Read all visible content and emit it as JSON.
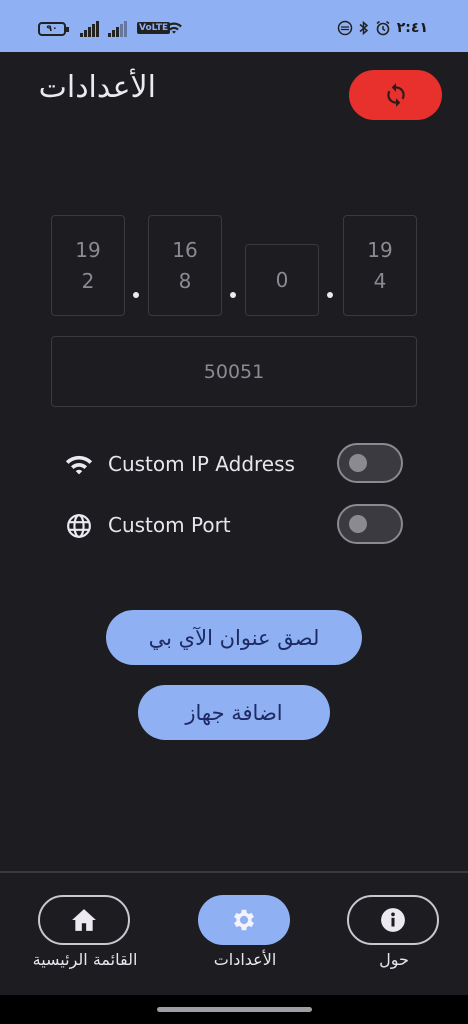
{
  "status_bar": {
    "battery": "٩٠",
    "volte": "VoLTE",
    "time": "٢:٤١",
    "icons": [
      "signal-icon",
      "signal-icon",
      "volte-icon",
      "wifi-icon",
      "data-saver-icon",
      "bluetooth-icon",
      "alarm-icon"
    ]
  },
  "header": {
    "title": "الأعدادات",
    "refresh_icon": "sync-icon",
    "refresh_color": "#e8302c"
  },
  "ip_address": {
    "octets": [
      "192",
      "168",
      "0",
      "194"
    ],
    "separator": "."
  },
  "port": {
    "value": "50051"
  },
  "settings": [
    {
      "icon": "wifi-icon",
      "label": "Custom IP Address",
      "enabled": false
    },
    {
      "icon": "globe-icon",
      "label": "Custom Port",
      "enabled": false
    }
  ],
  "actions": {
    "paste_ip": "لصق عنوان الآي بي",
    "add_device": "اضافة جهاز"
  },
  "nav": [
    {
      "icon": "home-icon",
      "label": "القائمة الرئيسية",
      "active": false
    },
    {
      "icon": "gear-icon",
      "label": "الأعدادات",
      "active": true
    },
    {
      "icon": "info-icon",
      "label": "حول",
      "active": false
    }
  ],
  "colors": {
    "background": "#1d1c21",
    "accent": "#8fb0f3",
    "danger": "#e8302c",
    "accent_text": "#1e2a63"
  }
}
